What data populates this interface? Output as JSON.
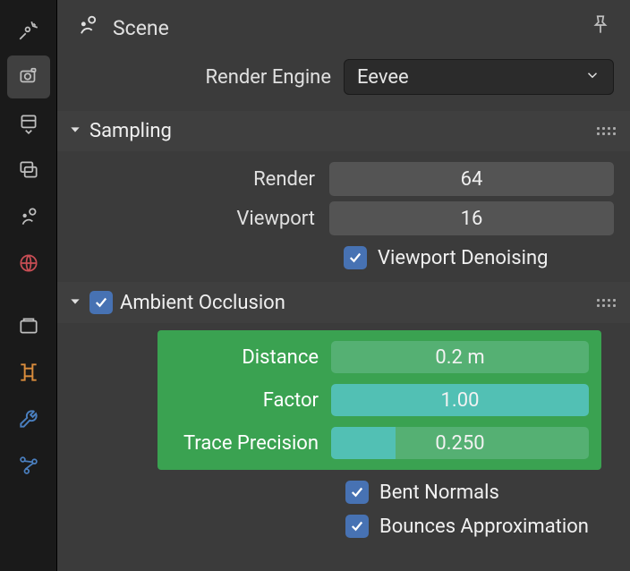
{
  "header": {
    "title": "Scene"
  },
  "render_engine": {
    "label": "Render Engine",
    "value": "Eevee"
  },
  "sampling": {
    "title": "Sampling",
    "render_label": "Render",
    "render_value": "64",
    "viewport_label": "Viewport",
    "viewport_value": "16",
    "denoising_label": "Viewport Denoising",
    "denoising_checked": true
  },
  "ao": {
    "title": "Ambient Occlusion",
    "enabled": true,
    "distance_label": "Distance",
    "distance_value": "0.2 m",
    "factor_label": "Factor",
    "factor_value": "1.00",
    "precision_label": "Trace Precision",
    "precision_value": "0.250",
    "precision_fraction": 0.25,
    "bent_label": "Bent Normals",
    "bent_checked": true,
    "bounces_label": "Bounces Approximation",
    "bounces_checked": true
  }
}
